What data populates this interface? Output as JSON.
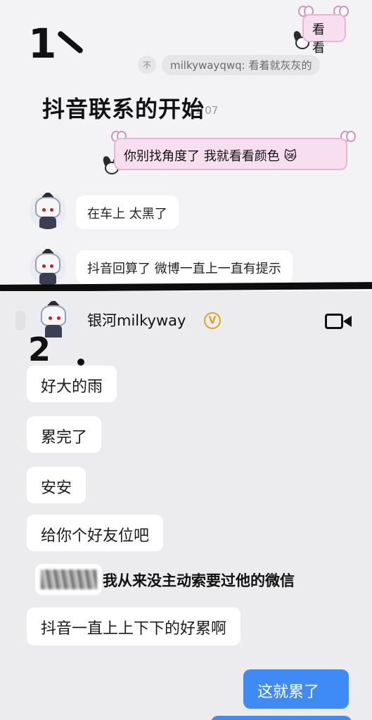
{
  "handwriting": {
    "label1": "1",
    "label2": "2"
  },
  "part1": {
    "sent_bubble_1": "看看",
    "quote": {
      "icon": "不",
      "text": "milkywayqwq: 看着就灰灰的"
    },
    "title_overlay": "抖音联系的开始",
    "date_ghost": "-11 07",
    "sent_bubble_2": "你别找角度了 我就看看颜色",
    "emoji": "😿",
    "received": [
      "在车上 太黑了",
      "抖音回算了 微博一直上一直有提示"
    ]
  },
  "part2": {
    "header": {
      "name": "银河milkyway",
      "verified": "V"
    },
    "received": [
      "好大的雨",
      "累完了",
      "安安",
      "给你个好友位吧"
    ],
    "overlay_note": "我从来没主动索要过他的微信",
    "received_last": "抖音一直上上下下的好累啊",
    "sent": "这就累了"
  }
}
